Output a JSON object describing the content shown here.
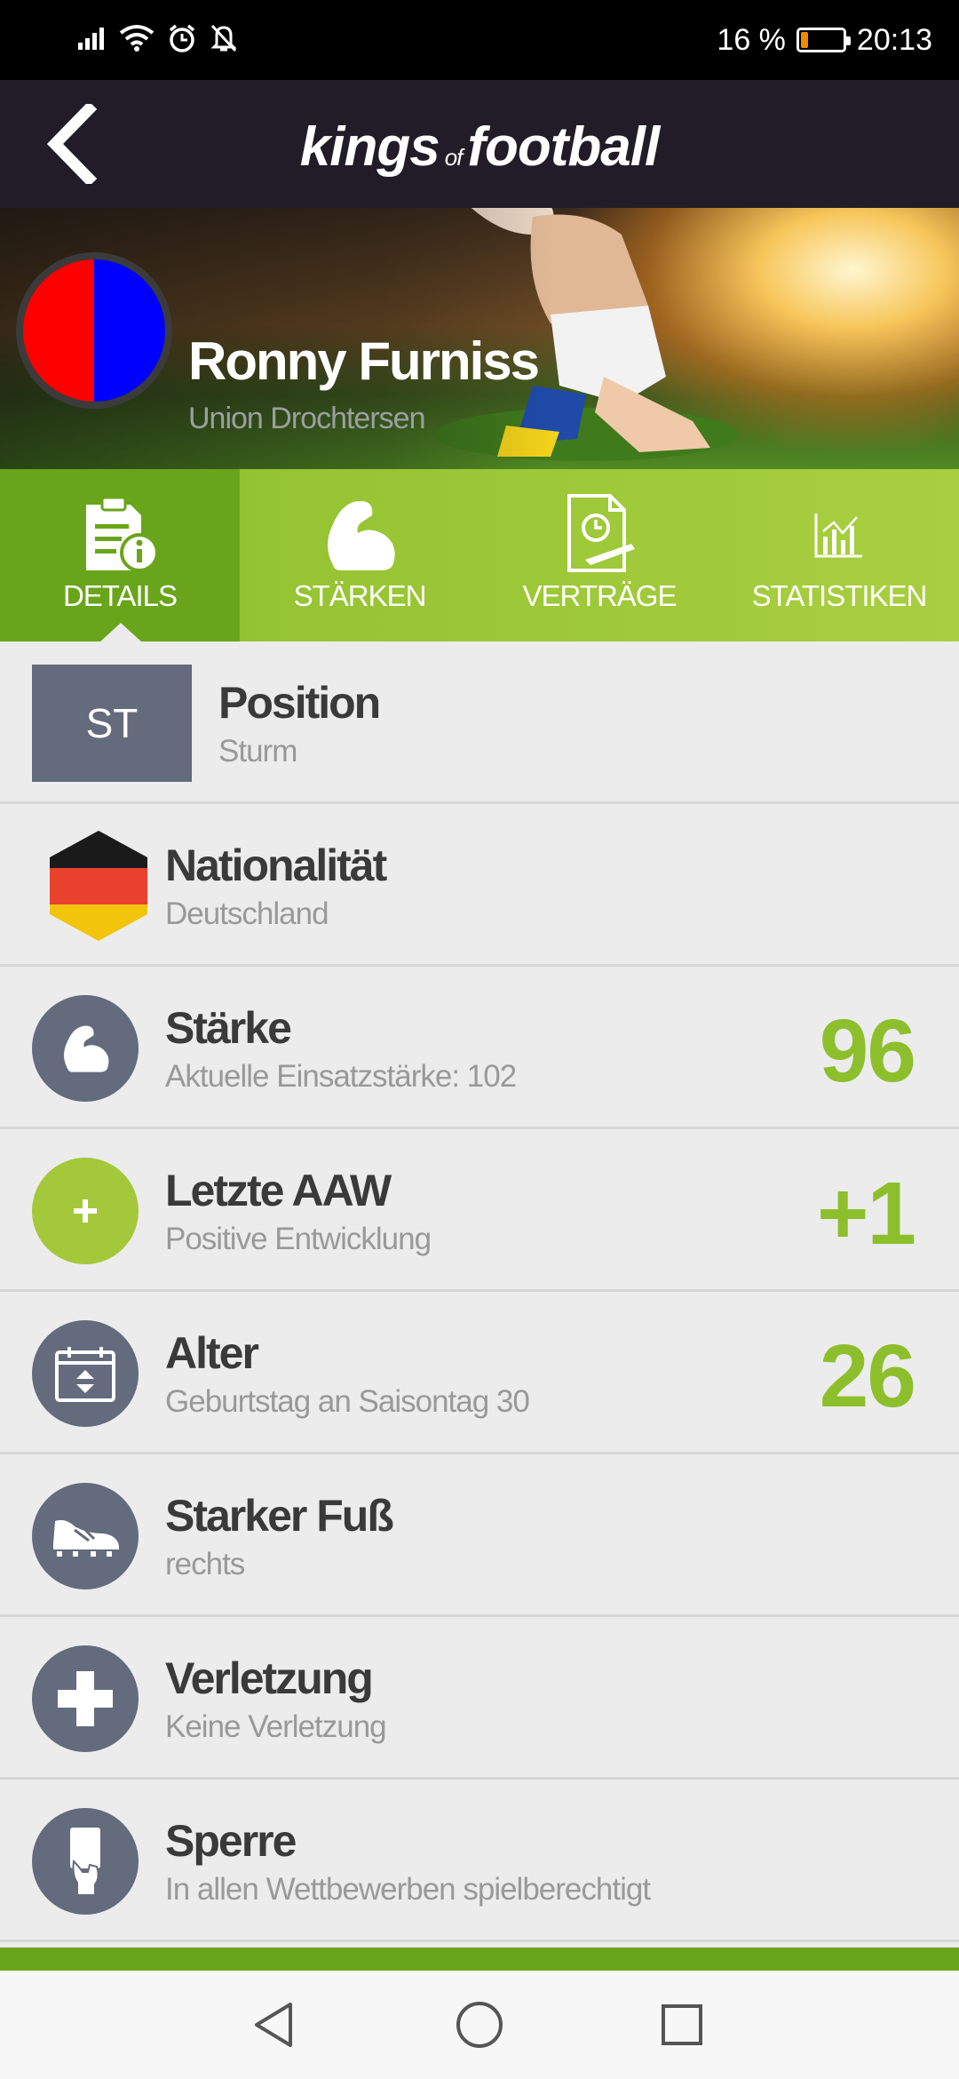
{
  "status_bar": {
    "battery_text": "16 %",
    "battery_level": 0.16,
    "time": "20:13",
    "icons": [
      "signal-icon",
      "wifi-icon",
      "alarm-icon",
      "notifications-off-icon"
    ]
  },
  "app": {
    "logo_left": "kings",
    "logo_of": "of",
    "logo_right": "football",
    "back_icon": "back-chevron-icon"
  },
  "player": {
    "name": "Ronny Furniss",
    "club": "Union Drochtersen",
    "club_colors": [
      "#ff0000",
      "#0000ff"
    ]
  },
  "tabs": [
    {
      "label": "DETAILS",
      "icon": "details-document-icon",
      "active": true
    },
    {
      "label": "STÄRKEN",
      "icon": "flexed-arm-icon",
      "active": false
    },
    {
      "label": "VERTRÄGE",
      "icon": "contract-icon",
      "active": false
    },
    {
      "label": "STATISTIKEN",
      "icon": "bar-chart-icon",
      "active": false
    }
  ],
  "rows": {
    "position": {
      "badge": "ST",
      "title": "Position",
      "sub": "Sturm"
    },
    "nationality": {
      "title": "Nationalität",
      "sub": "Deutschland",
      "icon": "germany-flag-icon"
    },
    "strength": {
      "title": "Stärke",
      "sub": "Aktuelle Einsatzstärke: 102",
      "value": "96",
      "icon": "flexed-arm-icon"
    },
    "last_aaw": {
      "title": "Letzte AAW",
      "sub": "Positive Entwicklung",
      "value": "+1",
      "icon": "plus-circle-icon"
    },
    "age": {
      "title": "Alter",
      "sub": "Geburtstag an Saisontag 30",
      "value": "26",
      "icon": "calendar-icon"
    },
    "strong_foot": {
      "title": "Starker Fuß",
      "sub": "rechts",
      "icon": "football-boot-icon"
    },
    "injury": {
      "title": "Verletzung",
      "sub": "Keine Verletzung",
      "icon": "medical-cross-icon"
    },
    "suspension": {
      "title": "Sperre",
      "sub": "In allen Wettbewerben spielberechtigt",
      "icon": "card-hand-icon"
    }
  },
  "colors": {
    "accent_green": "#8dbf2c",
    "active_tab": "#69a51a",
    "icon_gray": "#636b7d",
    "header_dark": "#211c27"
  },
  "nav_bar": [
    "back-triangle-icon",
    "home-circle-icon",
    "recents-square-icon"
  ]
}
